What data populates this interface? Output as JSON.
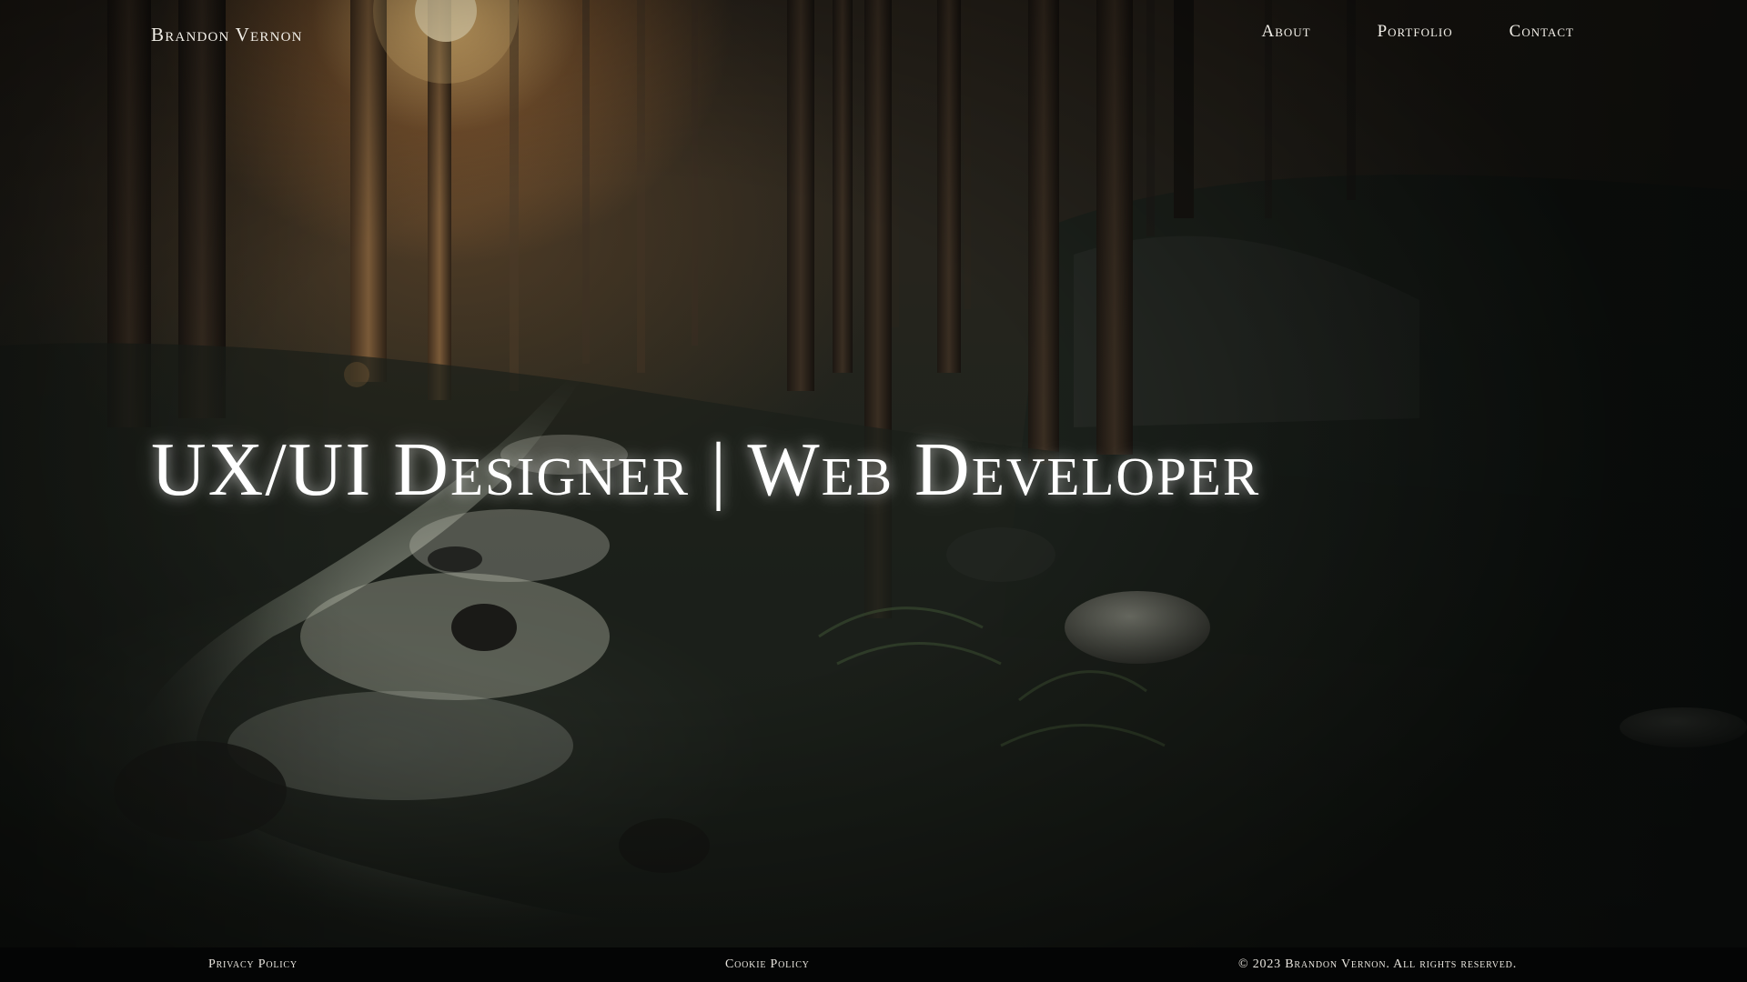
{
  "header": {
    "brand": "Brandon Vernon",
    "nav": [
      {
        "label": "About"
      },
      {
        "label": "Portfolio"
      },
      {
        "label": "Contact"
      }
    ]
  },
  "hero": {
    "headline": "UX/UI Designer | Web Developer",
    "background": "forest-stream-photo",
    "colors": {
      "sunlight": "#f6c476",
      "foliage": "#1f231d",
      "text": "#ffffff"
    }
  },
  "footer": {
    "privacy": "Privacy Policy",
    "cookie": "Cookie Policy",
    "copyright": "© 2023 Brandon Vernon. All rights reserved.",
    "background": "#040505"
  }
}
